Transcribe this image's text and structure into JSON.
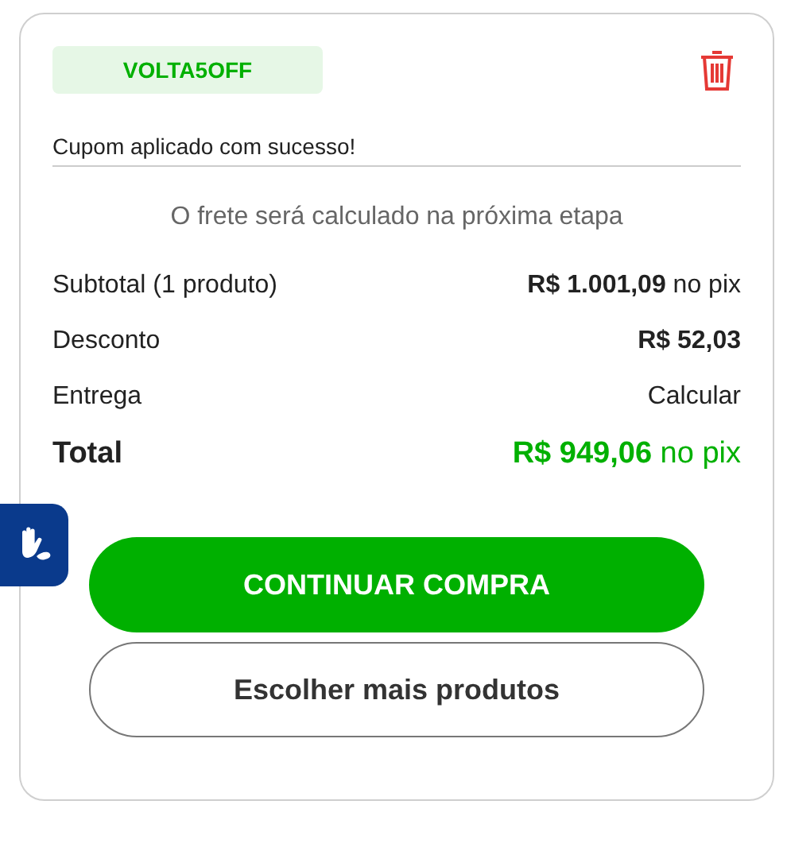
{
  "coupon": {
    "code": "VOLTA5OFF",
    "message": "Cupom aplicado com sucesso!"
  },
  "shipping_note": "O frete será calculado na próxima etapa",
  "summary": [
    {
      "kind": "line",
      "label": "Subtotal (1 produto)",
      "value": "**R$ 1.001,09** no pix"
    },
    {
      "kind": "line",
      "label": "Desconto",
      "value": "**R$ 52,03**"
    },
    {
      "kind": "line",
      "label": "Entrega",
      "value": "Calcular"
    },
    {
      "kind": "total",
      "label": "Total",
      "value": "**R$ 949,06** no pix"
    }
  ],
  "buttons": [
    {
      "kind": "primary",
      "label": "CONTINUAR COMPRA"
    },
    {
      "kind": "secondary",
      "label": "Escolher mais produtos"
    }
  ]
}
